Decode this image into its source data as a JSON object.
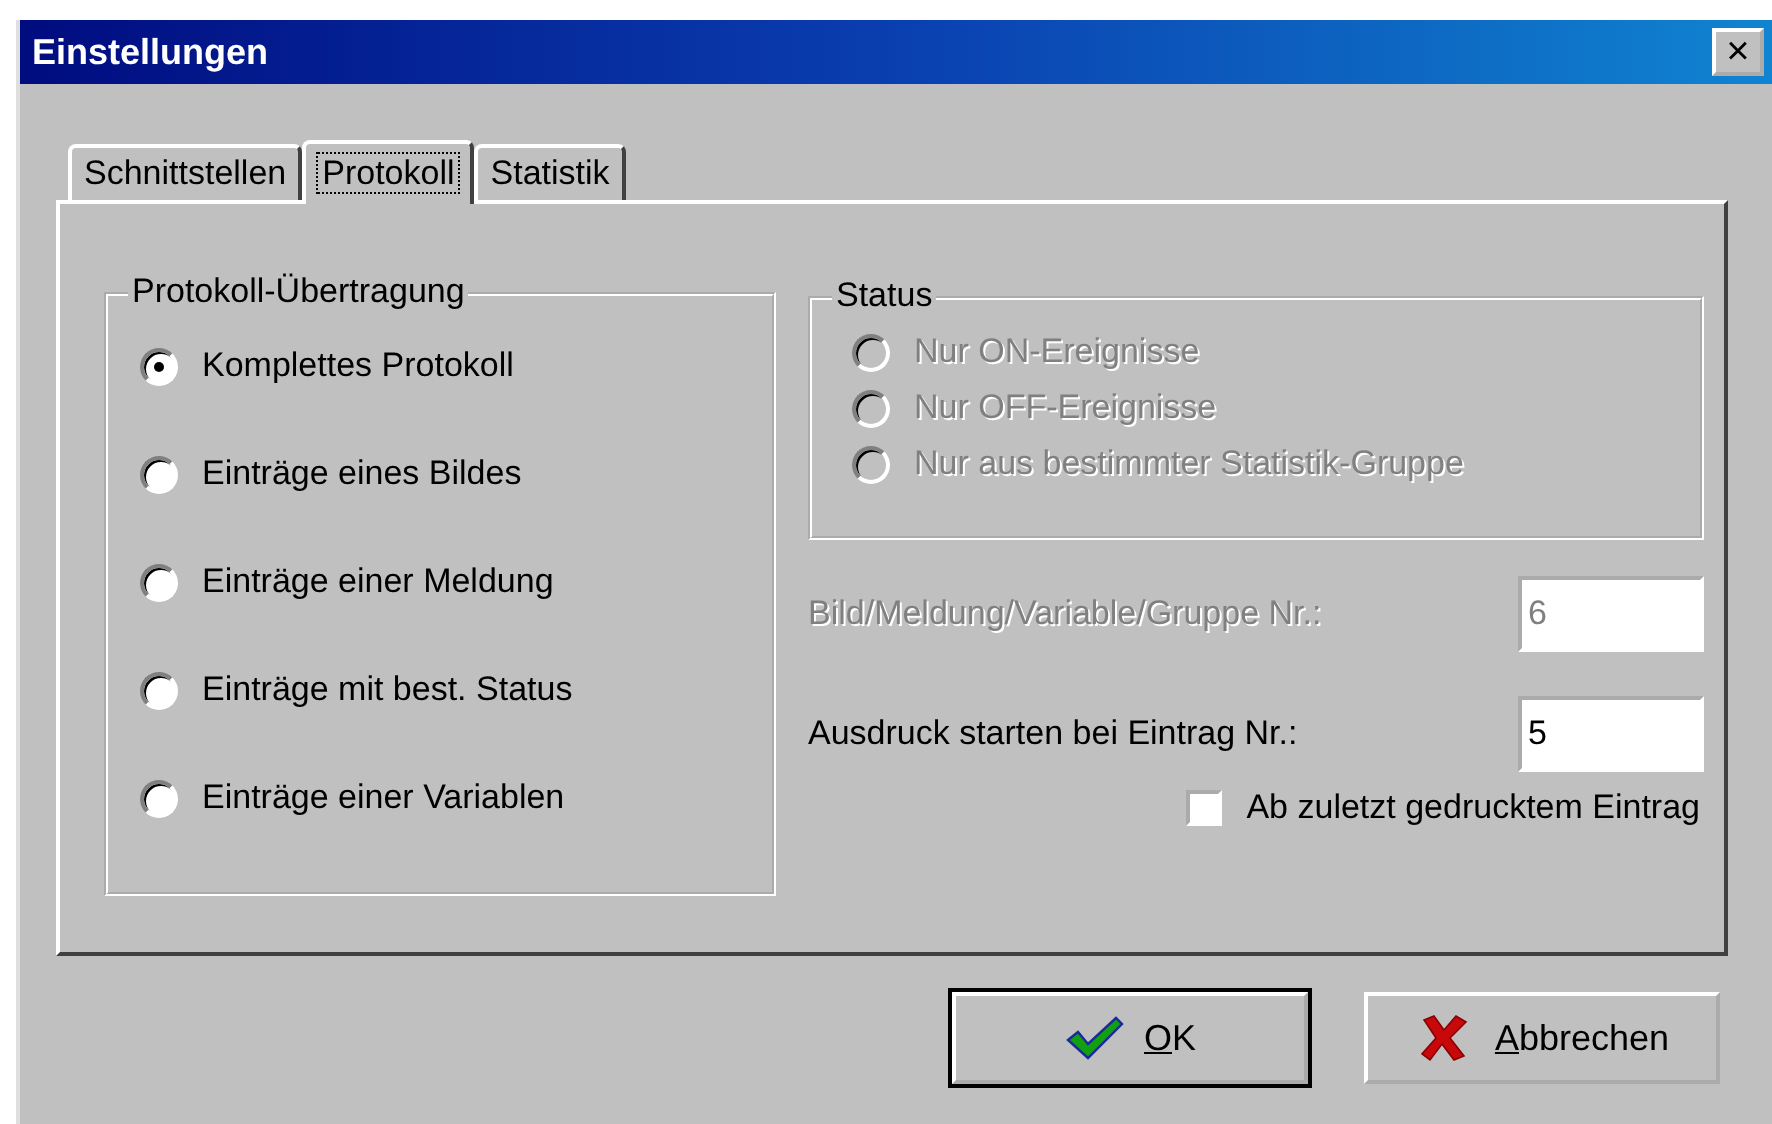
{
  "window": {
    "title": "Einstellungen",
    "close": "×"
  },
  "tabs": [
    {
      "label": "Schnittstellen",
      "selected": false
    },
    {
      "label": "Protokoll",
      "selected": true
    },
    {
      "label": "Statistik",
      "selected": false
    }
  ],
  "transfer_group": {
    "title": "Protokoll-Übertragung",
    "options": [
      {
        "label": "Komplettes Protokoll",
        "selected": true
      },
      {
        "label": "Einträge eines Bildes",
        "selected": false
      },
      {
        "label": "Einträge einer Meldung",
        "selected": false
      },
      {
        "label": "Einträge mit best. Status",
        "selected": false
      },
      {
        "label": "Einträge einer Variablen",
        "selected": false
      }
    ]
  },
  "status_group": {
    "title": "Status",
    "disabled": true,
    "options": [
      {
        "label": "Nur ON-Ereignisse",
        "selected": false
      },
      {
        "label": "Nur OFF-Ereignisse",
        "selected": false
      },
      {
        "label": "Nur aus bestimmter Statistik-Gruppe",
        "selected": false
      }
    ]
  },
  "fields": [
    {
      "label": "Bild/Meldung/Variable/Gruppe Nr.:",
      "value": "6",
      "disabled": true
    },
    {
      "label": "Ausdruck starten bei Eintrag Nr.:",
      "value": "5",
      "disabled": false
    }
  ],
  "checkbox": {
    "label": "Ab zuletzt gedrucktem Eintrag",
    "checked": false
  },
  "buttons": [
    {
      "kind": "ok",
      "mnemonic": "O",
      "label_rest": "K",
      "default": true
    },
    {
      "kind": "cancel",
      "mnemonic": "A",
      "label_rest": "bbrechen",
      "default": false
    }
  ]
}
